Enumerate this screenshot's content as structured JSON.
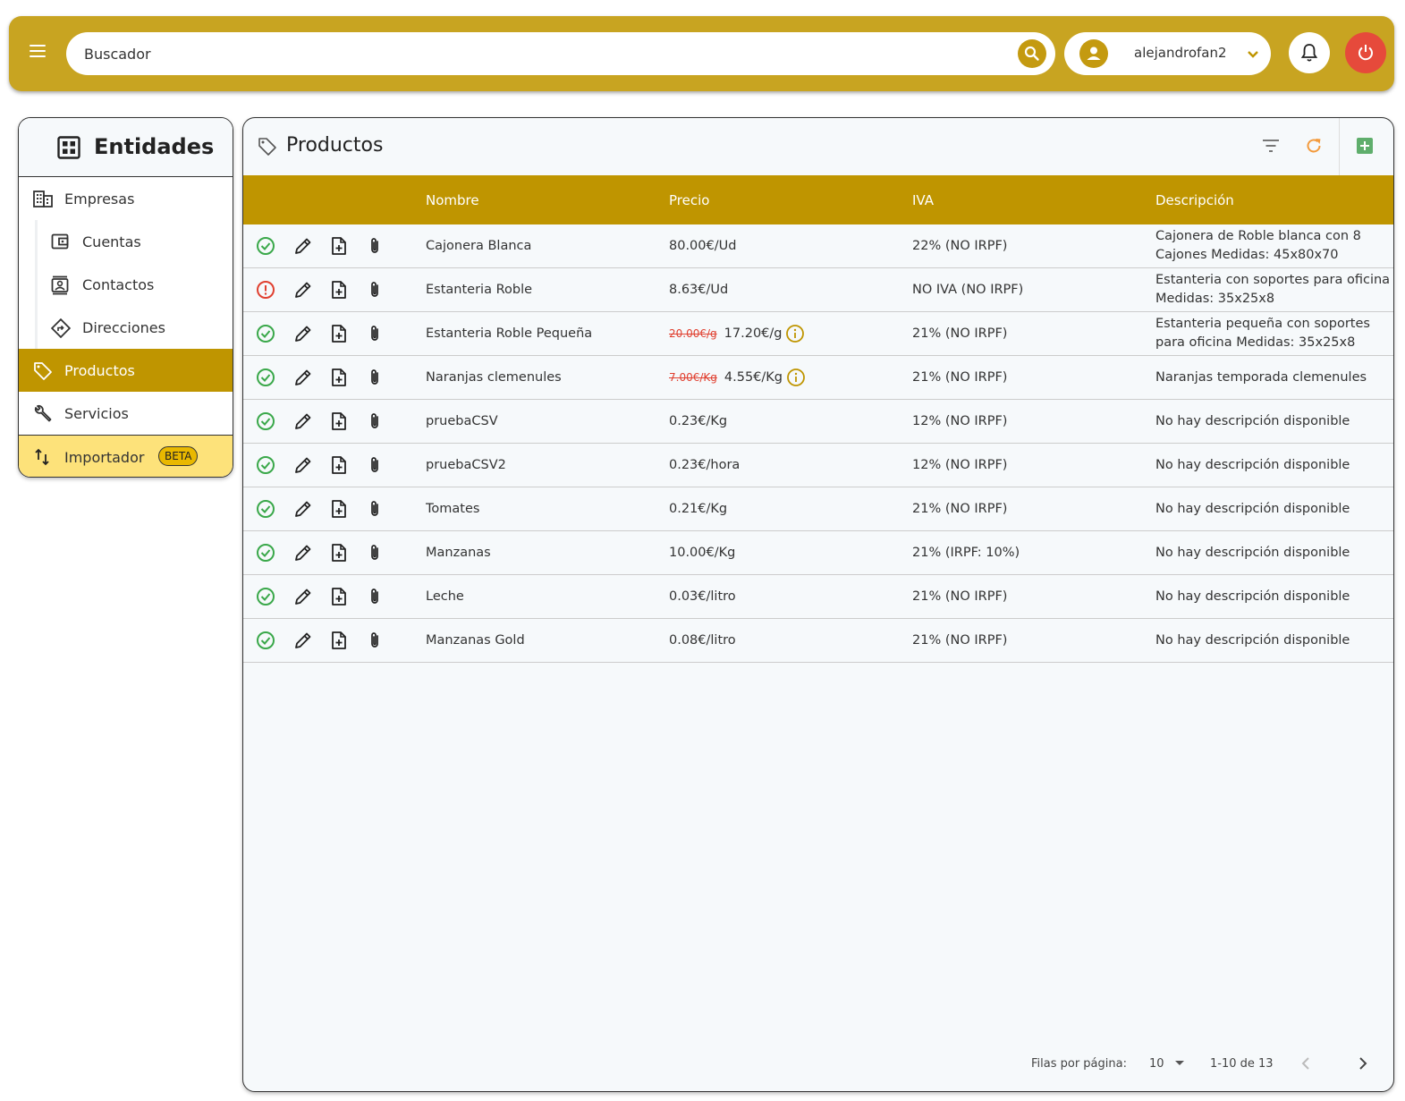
{
  "header": {
    "search_placeholder": "Buscador",
    "username": "alejandrofan2"
  },
  "sidebar": {
    "title": "Entidades",
    "items": [
      {
        "label": "Empresas",
        "icon": "building-icon"
      },
      {
        "label": "Cuentas",
        "icon": "wallet-icon"
      },
      {
        "label": "Contactos",
        "icon": "contact-card-icon"
      },
      {
        "label": "Direcciones",
        "icon": "directions-icon"
      },
      {
        "label": "Productos",
        "icon": "tag-icon"
      },
      {
        "label": "Servicios",
        "icon": "wrench-icon"
      }
    ],
    "importer": {
      "label": "Importador",
      "badge": "BETA"
    }
  },
  "main": {
    "title": "Productos",
    "columns": [
      "Nombre",
      "Precio",
      "IVA",
      "Descripción"
    ],
    "rows": [
      {
        "status": "ok",
        "name": "Cajonera Blanca",
        "old_price": "",
        "price": "80.00€/Ud",
        "iva": "22% (NO IRPF)",
        "desc": "Cajonera de Roble blanca con 8 Cajones Medidas: 45x80x70"
      },
      {
        "status": "error",
        "name": "Estanteria Roble",
        "old_price": "",
        "price": "8.63€/Ud",
        "iva": "NO IVA (NO IRPF)",
        "desc": "Estanteria con soportes para oficina Medidas: 35x25x8"
      },
      {
        "status": "ok",
        "name": "Estanteria Roble Pequeña",
        "old_price": "20.00€/g",
        "price": "17.20€/g",
        "iva": "21% (NO IRPF)",
        "desc": "Estanteria pequeña con soportes para oficina Medidas: 35x25x8"
      },
      {
        "status": "ok",
        "name": "Naranjas clemenules",
        "old_price": "7.00€/Kg",
        "price": "4.55€/Kg",
        "iva": "21% (NO IRPF)",
        "desc": "Naranjas temporada clemenules"
      },
      {
        "status": "ok",
        "name": "pruebaCSV",
        "old_price": "",
        "price": "0.23€/Kg",
        "iva": "12% (NO IRPF)",
        "desc": "No hay descripción disponible"
      },
      {
        "status": "ok",
        "name": "pruebaCSV2",
        "old_price": "",
        "price": "0.23€/hora",
        "iva": "12% (NO IRPF)",
        "desc": "No hay descripción disponible"
      },
      {
        "status": "ok",
        "name": "Tomates",
        "old_price": "",
        "price": "0.21€/Kg",
        "iva": "21% (NO IRPF)",
        "desc": "No hay descripción disponible"
      },
      {
        "status": "ok",
        "name": "Manzanas",
        "old_price": "",
        "price": "10.00€/Kg",
        "iva": "21% (IRPF: 10%)",
        "desc": "No hay descripción disponible"
      },
      {
        "status": "ok",
        "name": "Leche",
        "old_price": "",
        "price": "0.03€/litro",
        "iva": "21% (NO IRPF)",
        "desc": "No hay descripción disponible"
      },
      {
        "status": "ok",
        "name": "Manzanas Gold",
        "old_price": "",
        "price": "0.08€/litro",
        "iva": "21% (NO IRPF)",
        "desc": "No hay descripción disponible"
      }
    ]
  },
  "pagination": {
    "rows_label": "Filas por página:",
    "rows_value": "10",
    "range": "1-10 de 13"
  },
  "colors": {
    "brand": "#c8a421",
    "header_row": "#bf9500",
    "ok": "#3aa84a",
    "error": "#e04030",
    "power": "#e64a3b",
    "importer_bg": "#fde27a"
  }
}
